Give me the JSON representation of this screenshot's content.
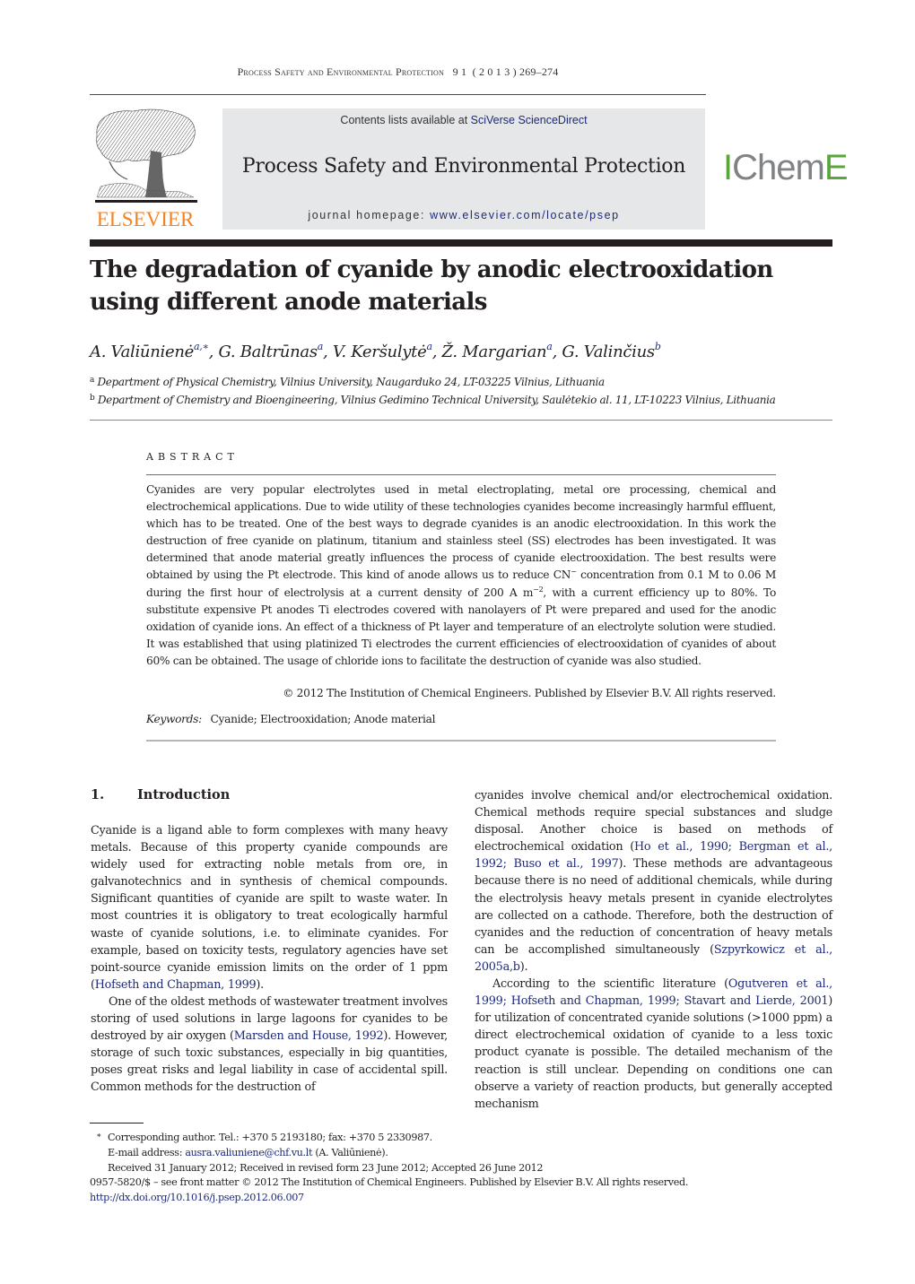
{
  "running_header": {
    "journal": "Process Safety and Environmental Protection",
    "volume": "9 1",
    "year": "( 2 0 1 3 )",
    "pages": "269–274"
  },
  "masthead": {
    "publisher_logo_text": "ELSEVIER",
    "contents_prefix": "Contents lists available at ",
    "contents_link": "SciVerse ScienceDirect",
    "journal_name": "Process Safety and Environmental Protection",
    "homepage_prefix": "journal homepage: ",
    "homepage_link": "www.elsevier.com/locate/psep",
    "society_logo": {
      "part1": "I",
      "part2": "Chem",
      "part3": "E"
    },
    "colors": {
      "elsevier_orange": "#f58220",
      "icheme_green": "#5aa63a",
      "icheme_grey": "#808285",
      "link_blue": "#1d2a7a",
      "masthead_grey": "#e6e7e8"
    }
  },
  "article": {
    "title": "The degradation of cyanide by anodic electrooxidation using different anode materials",
    "authors": [
      {
        "name": "A. Valiūnienė",
        "affil": "a,∗"
      },
      {
        "name": "G. Baltrūnas",
        "affil": "a"
      },
      {
        "name": "V. Keršulytė",
        "affil": "a"
      },
      {
        "name": "Ž. Margarian",
        "affil": "a"
      },
      {
        "name": "G. Valinčius",
        "affil": "b"
      }
    ],
    "affiliations": [
      {
        "mark": "a",
        "text": "Department of Physical Chemistry, Vilnius University, Naugarduko 24, LT-03225 Vilnius, Lithuania"
      },
      {
        "mark": "b",
        "text": "Department of Chemistry and Bioengineering, Vilnius Gedimino Technical University, Saulėtekio al. 11, LT-10223 Vilnius, Lithuania"
      }
    ]
  },
  "abstract": {
    "heading": "ABSTRACT",
    "part1": "Cyanides are very popular electrolytes used in metal electroplating, metal ore processing, chemical and electrochemical applications. Due to wide utility of these technologies cyanides become increasingly harmful effluent, which has to be treated. One of the best ways to degrade cyanides is an anodic electrooxidation. In this work the destruction of free cyanide on platinum, titanium and stainless steel (SS) electrodes has been investigated. It was determined that anode material greatly influences the process of cyanide electrooxidation. The best results were obtained by using the Pt electrode. This kind of anode allows us to reduce CN",
    "sup1": "−",
    "part2": " concentration from 0.1 M to 0.06 M during the first hour of electrolysis at a current density of 200 A m",
    "sup2": "−2",
    "part3": ", with a current efficiency up to 80%. To substitute expensive Pt anodes Ti electrodes covered with nanolayers of Pt were prepared and used for the anodic oxidation of cyanide ions. An effect of a thickness of Pt layer and temperature of an electrolyte solution were studied. It was established that using platinized Ti electrodes the current efficiencies of electrooxidation of cyanides of about 60% can be obtained. The usage of chloride ions to facilitate the destruction of cyanide was also studied.",
    "copyright": "© 2012 The Institution of Chemical Engineers. Published by Elsevier B.V. All rights reserved.",
    "keywords_label": "Keywords:",
    "keywords": "Cyanide; Electrooxidation; Anode material"
  },
  "section1": {
    "number": "1.",
    "title": "Introduction",
    "p1_a": "Cyanide is a ligand able to form complexes with many heavy metals. Because of this property cyanide compounds are widely used for extracting noble metals from ore, in galvanotechnics and in synthesis of chemical compounds. Significant quantities of cyanide are spilt to waste water. In most countries it is obligatory to treat ecologically harmful waste of cyanide solutions, i.e. to eliminate cyanides. For example, based on toxicity tests, regulatory agencies have set point-source cyanide emission limits on the order of 1 ppm (",
    "p1_ref": "Hofseth and Chapman, 1999",
    "p1_b": ").",
    "p2_a": "One of the oldest methods of wastewater treatment involves storing of used solutions in large lagoons for cyanides to be destroyed by air oxygen (",
    "p2_ref": "Marsden and House, 1992",
    "p2_b": "). However, storage of such toxic substances, especially in big quantities, poses great risks and legal liability in case of accidental spill. Common methods for the destruction of",
    "p3_a": "cyanides involve chemical and/or electrochemical oxidation. Chemical methods require special substances and sludge disposal. Another choice is based on methods of electrochemical oxidation (",
    "p3_ref1": "Ho et al., 1990",
    "p3_sep1": "; ",
    "p3_ref2": "Bergman et al., 1992",
    "p3_sep2": "; ",
    "p3_ref3": "Buso et al., 1997",
    "p3_b": "). These methods are advantageous because there is no need of additional chemicals, while during the electrolysis heavy metals present in cyanide electrolytes are collected on a cathode. Therefore, both the destruction of cyanides and the reduction of concentration of heavy metals can be accomplished simultaneously (",
    "p3_ref4": "Szpyrkowicz et al., 2005a,b",
    "p3_c": ").",
    "p4_a": "According to the scientific literature (",
    "p4_ref1": "Ogutveren et al., 1999",
    "p4_sep1": "; ",
    "p4_ref2": "Hofseth and Chapman, 1999",
    "p4_sep2": "; ",
    "p4_ref3": "Stavart and Lierde, 2001",
    "p4_b": ") for utilization of concentrated cyanide solutions (>1000 ppm) a direct electrochemical oxidation of cyanide to a less toxic product cyanate is possible. The detailed mechanism of the reaction is still unclear. Depending on conditions one can observe a variety of reaction products, but generally accepted mechanism"
  },
  "footnotes": {
    "star": "∗",
    "corresponding": "Corresponding author. Tel.: +370 5 2193180; fax: +370 5 2330987.",
    "email_label": "E-mail address: ",
    "email": "ausra.valiuniene@chf.vu.lt",
    "email_suffix": " (A. Valiūnienė).",
    "history": "Received 31 January 2012; Received in revised form 23 June 2012; Accepted 26 June 2012",
    "issn_line": "0957-5820/$ – see front matter © 2012 The Institution of Chemical Engineers. Published by Elsevier B.V. All rights reserved.",
    "doi": "http://dx.doi.org/10.1016/j.psep.2012.06.007"
  }
}
